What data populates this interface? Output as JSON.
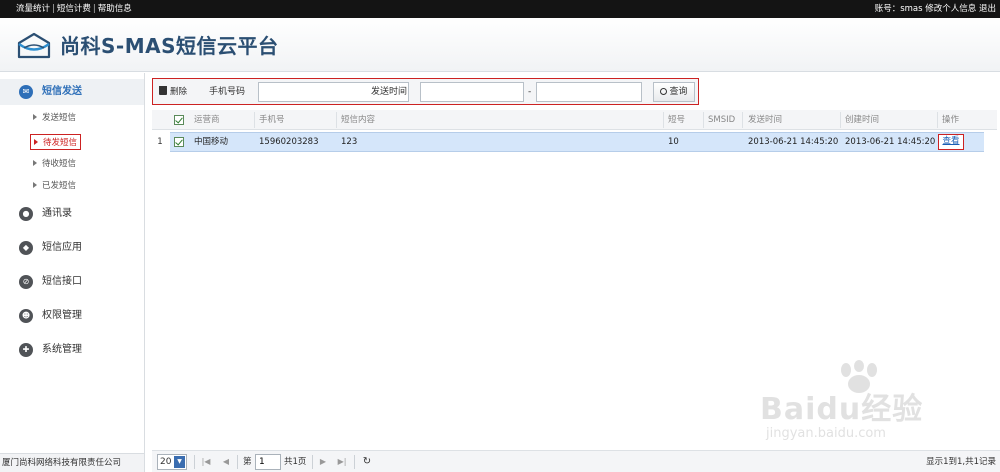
{
  "topbar": {
    "links": [
      "流量统计",
      "短信计费",
      "帮助信息"
    ],
    "account_label": "账号：smas",
    "profile_link": "修改个人信息",
    "logout_link": "退出"
  },
  "header": {
    "brand": "尚科S-MAS短信云平台"
  },
  "sidebar": {
    "groups": [
      {
        "label": "短信发送",
        "icon": "envelope-icon"
      },
      {
        "label": "通讯录",
        "icon": "contact-icon"
      },
      {
        "label": "短信应用",
        "icon": "share-icon"
      },
      {
        "label": "短信接口",
        "icon": "plug-icon"
      },
      {
        "label": "权限管理",
        "icon": "users-icon"
      },
      {
        "label": "系统管理",
        "icon": "wrench-icon"
      }
    ],
    "sub_items": [
      "发送短信",
      "待发短信",
      "待收短信",
      "已发短信"
    ],
    "footer": "厦门尚科网络科技有限责任公司"
  },
  "toolbar": {
    "delete_label": "删除",
    "phone_label": "手机号码",
    "phone_value": "",
    "time_label": "发送时间",
    "time_from": "",
    "time_dash": "-",
    "time_to": "",
    "search_label": "查询"
  },
  "grid": {
    "columns": [
      "运营商",
      "手机号",
      "短信内容",
      "短号",
      "SMSID",
      "发送时间",
      "创建时间",
      "操作"
    ],
    "rows": [
      {
        "num": "1",
        "carrier": "中国移动",
        "phone": "15960203283",
        "content": "123",
        "short_no": "10",
        "smsid": "",
        "send_time": "2013-06-21 14:45:20",
        "create_time": "2013-06-21 14:45:20",
        "action": "查看"
      }
    ]
  },
  "pager": {
    "page_size": "20",
    "page_prefix": "第",
    "page_value": "1",
    "page_suffix": "共1页",
    "info": "显示1到1,共1记录"
  },
  "watermark": {
    "brand": "Baidu经验",
    "url": "jingyan.baidu.com"
  },
  "colors": {
    "accent": "#2e6fb8",
    "highlight_box": "#cc2222",
    "selected_row": "#d5e6fa"
  }
}
